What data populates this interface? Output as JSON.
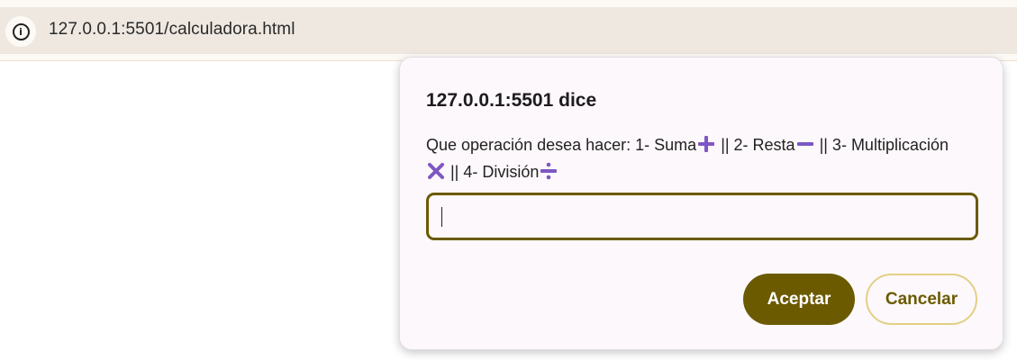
{
  "browser": {
    "address_host": "127.0.0.1",
    "address_rest": ":5501/calculadora.html",
    "site_info_icon": "info-icon"
  },
  "dialog": {
    "title": "127.0.0.1:5501 dice",
    "message_parts": {
      "p1": "Que operación desea hacer: 1- Suma",
      "p2": " || 2- Resta",
      "p3": " || 3- Multiplicación",
      "p4": " || 4- División"
    },
    "icons": [
      "plus-icon",
      "minus-icon",
      "multiply-icon",
      "divide-icon"
    ],
    "icon_color": "#7e57c2",
    "input_value": "",
    "ok_label": "Aceptar",
    "cancel_label": "Cancelar",
    "accent_color": "#6b5a00"
  }
}
